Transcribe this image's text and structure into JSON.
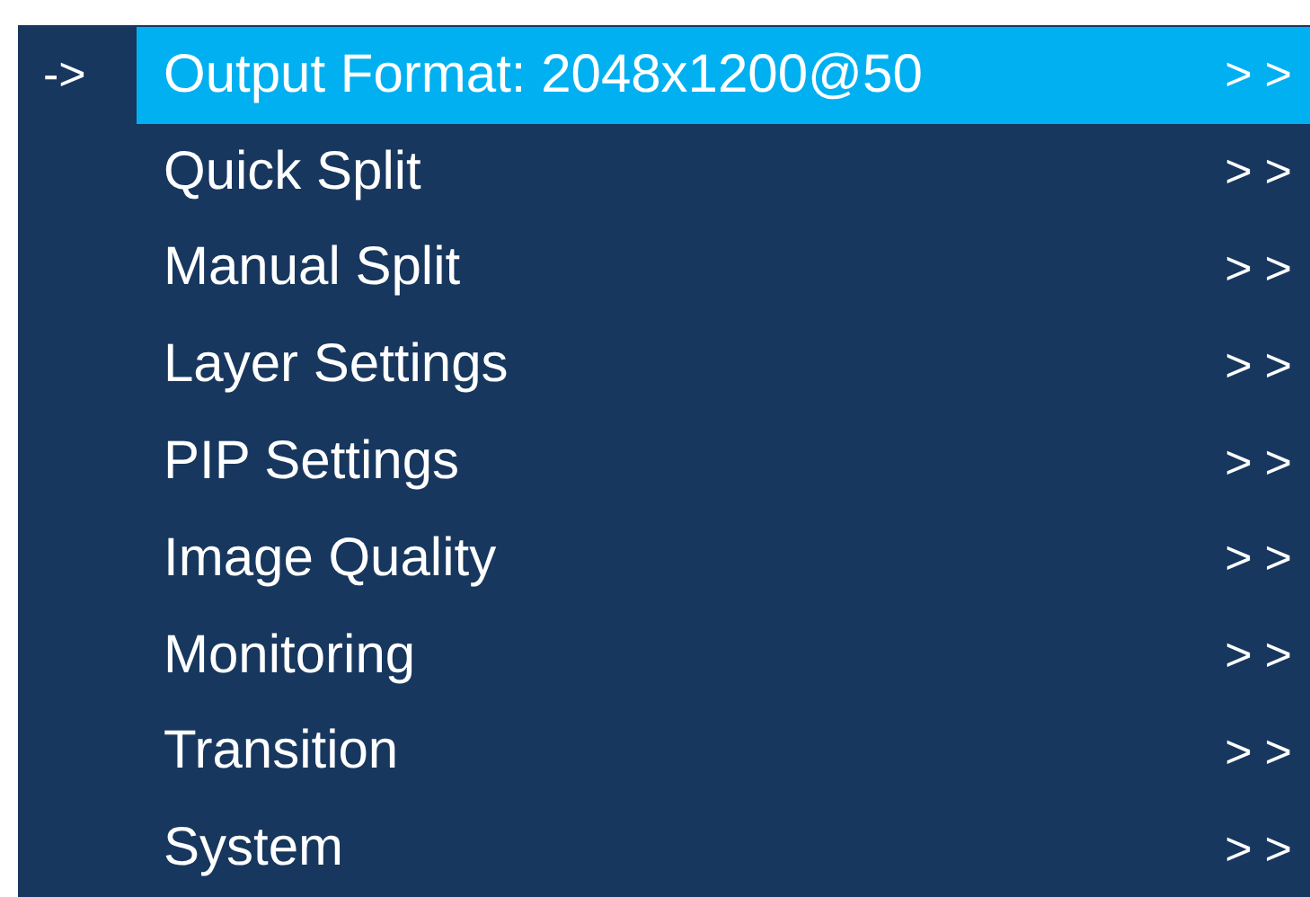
{
  "menu": {
    "pointer": "->",
    "items": [
      {
        "label": "Output Format: 2048x1200@50",
        "arrow": ">>",
        "selected": true
      },
      {
        "label": "Quick Split",
        "arrow": ">>",
        "selected": false
      },
      {
        "label": "Manual Split",
        "arrow": ">>",
        "selected": false
      },
      {
        "label": "Layer Settings",
        "arrow": ">>",
        "selected": false
      },
      {
        "label": "PIP Settings",
        "arrow": ">>",
        "selected": false
      },
      {
        "label": "Image Quality",
        "arrow": ">>",
        "selected": false
      },
      {
        "label": "Monitoring",
        "arrow": ">>",
        "selected": false
      },
      {
        "label": "Transition",
        "arrow": ">>",
        "selected": false
      },
      {
        "label": "System",
        "arrow": ">>",
        "selected": false
      }
    ]
  }
}
